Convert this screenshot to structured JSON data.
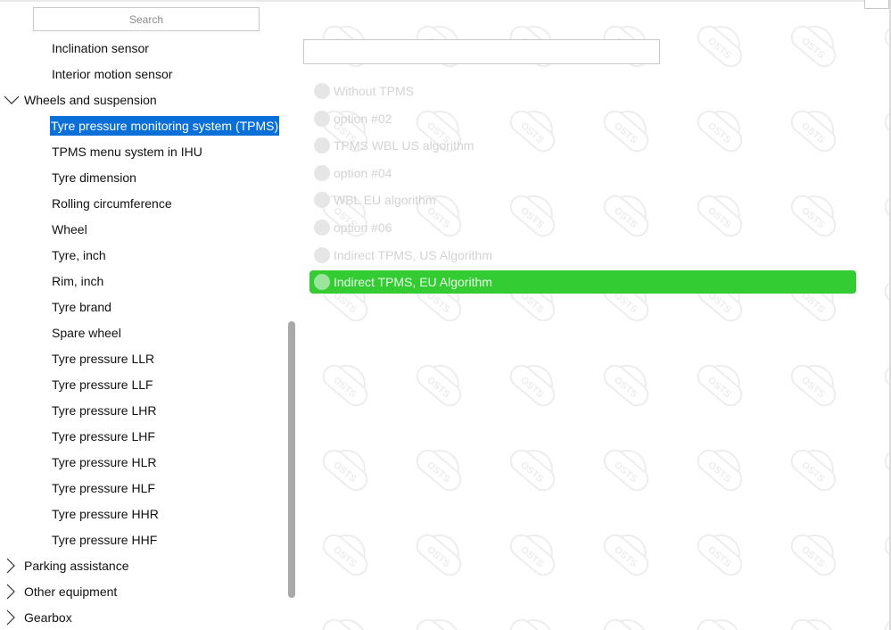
{
  "search": {
    "placeholder": "Search"
  },
  "tree": {
    "items": [
      {
        "label": "Inclination sensor",
        "level": "child"
      },
      {
        "label": "Interior motion sensor",
        "level": "child"
      },
      {
        "label": "Wheels and suspension",
        "level": "parent",
        "state": "expanded"
      },
      {
        "label": "Tyre pressure monitoring system (TPMS)",
        "level": "child",
        "selected": true
      },
      {
        "label": "TPMS menu system in IHU",
        "level": "child"
      },
      {
        "label": "Tyre dimension",
        "level": "child"
      },
      {
        "label": "Rolling circumference",
        "level": "child"
      },
      {
        "label": "Wheel",
        "level": "child"
      },
      {
        "label": "Tyre, inch",
        "level": "child"
      },
      {
        "label": "Rim, inch",
        "level": "child"
      },
      {
        "label": "Tyre brand",
        "level": "child"
      },
      {
        "label": "Spare wheel",
        "level": "child"
      },
      {
        "label": "Tyre pressure LLR",
        "level": "child"
      },
      {
        "label": "Tyre pressure LLF",
        "level": "child"
      },
      {
        "label": "Tyre pressure LHR",
        "level": "child"
      },
      {
        "label": "Tyre pressure LHF",
        "level": "child"
      },
      {
        "label": "Tyre pressure HLR",
        "level": "child"
      },
      {
        "label": "Tyre pressure HLF",
        "level": "child"
      },
      {
        "label": "Tyre pressure HHR",
        "level": "child"
      },
      {
        "label": "Tyre pressure HHF",
        "level": "child"
      },
      {
        "label": "Parking assistance",
        "level": "parent",
        "state": "collapsed"
      },
      {
        "label": "Other equipment",
        "level": "parent",
        "state": "collapsed"
      },
      {
        "label": "Gearbox",
        "level": "parent",
        "state": "collapsed"
      }
    ]
  },
  "value_field": {
    "value": ""
  },
  "options": [
    {
      "label": "Without TPMS",
      "selected": false
    },
    {
      "label": "option #02",
      "selected": false
    },
    {
      "label": "TPMS WBL US algorithm",
      "selected": false
    },
    {
      "label": "option #04",
      "selected": false
    },
    {
      "label": "WBL EU algorithm",
      "selected": false
    },
    {
      "label": "option #06",
      "selected": false
    },
    {
      "label": "Indirect TPMS, US Algorithm",
      "selected": false
    },
    {
      "label": "Indirect TPMS, EU Algorithm",
      "selected": true
    }
  ],
  "colors": {
    "selection": "#0a6fd7",
    "selected_option": "#33cc33"
  },
  "icons": {
    "expanded": "chevron-down-icon",
    "collapsed": "chevron-right-icon"
  }
}
